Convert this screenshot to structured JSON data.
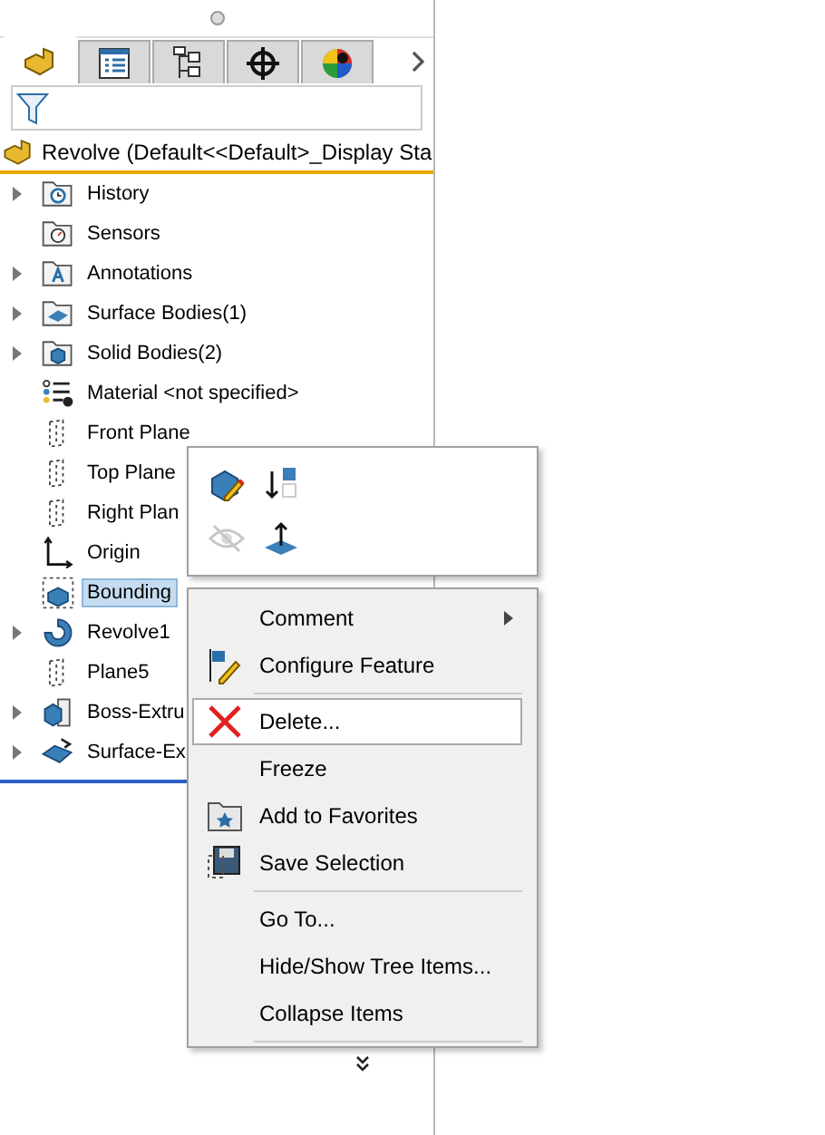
{
  "tabs": [
    {
      "kind": "part",
      "selected": true
    },
    {
      "kind": "list",
      "selected": false
    },
    {
      "kind": "config",
      "selected": false
    },
    {
      "kind": "target",
      "selected": false
    },
    {
      "kind": "appearance",
      "selected": false
    }
  ],
  "header": {
    "title": "Revolve  (Default<<Default>_Display Sta"
  },
  "tree": [
    {
      "label": "History",
      "kind": "history",
      "expandable": true,
      "selected": false
    },
    {
      "label": "Sensors",
      "kind": "sensors",
      "expandable": false,
      "selected": false
    },
    {
      "label": "Annotations",
      "kind": "annotations",
      "expandable": true,
      "selected": false
    },
    {
      "label": "Surface Bodies(1)",
      "kind": "surfacebodies",
      "expandable": true,
      "selected": false
    },
    {
      "label": "Solid Bodies(2)",
      "kind": "solidbodies",
      "expandable": true,
      "selected": false
    },
    {
      "label": "Material <not specified>",
      "kind": "material",
      "expandable": false,
      "selected": false
    },
    {
      "label": "Front Plane",
      "kind": "plane",
      "expandable": false,
      "selected": false
    },
    {
      "label": "Top Plane",
      "kind": "plane",
      "expandable": false,
      "selected": false
    },
    {
      "label": "Right Plan",
      "kind": "plane",
      "expandable": false,
      "selected": false
    },
    {
      "label": "Origin",
      "kind": "origin",
      "expandable": false,
      "selected": false
    },
    {
      "label": "Bounding",
      "kind": "box",
      "expandable": false,
      "selected": true
    },
    {
      "label": "Revolve1",
      "kind": "revolve",
      "expandable": true,
      "selected": false
    },
    {
      "label": "Plane5",
      "kind": "plane",
      "expandable": false,
      "selected": false
    },
    {
      "label": "Boss-Extru",
      "kind": "extrude",
      "expandable": true,
      "selected": false
    },
    {
      "label": "Surface-Ex",
      "kind": "surfaceextrude",
      "expandable": true,
      "selected": false
    }
  ],
  "mini_toolbar": [
    {
      "kind": "edit",
      "disabled": false
    },
    {
      "kind": "suppress",
      "disabled": false
    },
    {
      "kind": "hide",
      "disabled": true
    },
    {
      "kind": "normal",
      "disabled": false
    }
  ],
  "context_menu": [
    {
      "kind": "comment",
      "label": "Comment",
      "submenu": true,
      "selected": false
    },
    {
      "kind": "configure",
      "label": "Configure Feature",
      "submenu": false,
      "selected": false
    },
    {
      "kind": "separator"
    },
    {
      "kind": "delete",
      "label": "Delete...",
      "submenu": false,
      "selected": true
    },
    {
      "kind": "freeze",
      "label": "Freeze",
      "submenu": false,
      "selected": false
    },
    {
      "kind": "favorites",
      "label": "Add to Favorites",
      "submenu": false,
      "selected": false
    },
    {
      "kind": "save",
      "label": "Save Selection",
      "submenu": false,
      "selected": false
    },
    {
      "kind": "separator"
    },
    {
      "kind": "goto",
      "label": "Go To...",
      "submenu": false,
      "selected": false
    },
    {
      "kind": "hidetree",
      "label": "Hide/Show Tree Items...",
      "submenu": false,
      "selected": false
    },
    {
      "kind": "collapse",
      "label": "Collapse Items",
      "submenu": false,
      "selected": false
    },
    {
      "kind": "separator"
    },
    {
      "kind": "more"
    }
  ]
}
